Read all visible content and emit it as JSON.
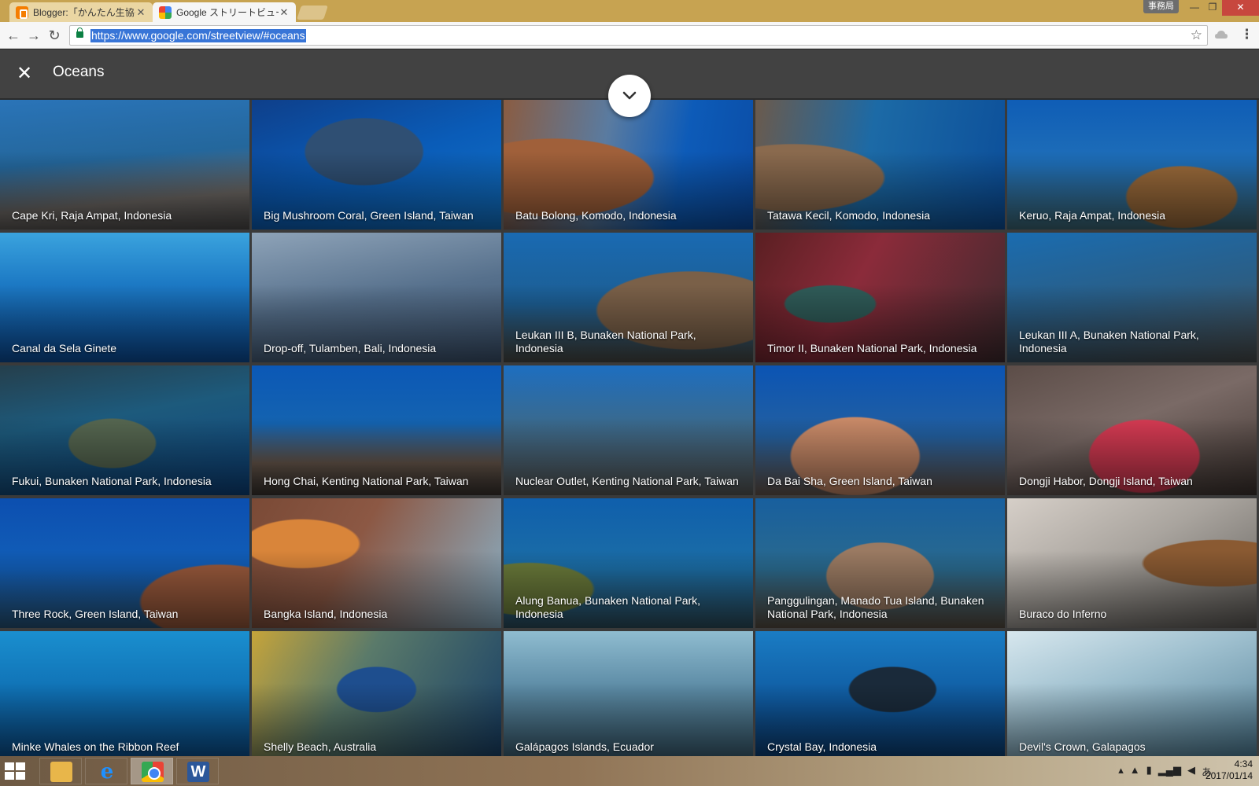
{
  "browser": {
    "tabs": [
      {
        "label": "Blogger:「かんたん生協ゲ",
        "favicon": "blogger-icon"
      },
      {
        "label": "Google ストリートビュー – ",
        "favicon": "street-view-icon"
      }
    ],
    "profile_badge": "事務局",
    "url": "https://www.google.com/streetview/#oceans",
    "colors": {
      "frame": "#c7a351",
      "selection": "#3875d7",
      "lock": "#0b8043"
    }
  },
  "page": {
    "title": "Oceans",
    "close_icon": "close-icon",
    "collapse_icon": "chevron-down-icon",
    "header_color": "#424242"
  },
  "tiles": [
    "Cape Kri, Raja Ampat, Indonesia",
    "Big Mushroom Coral, Green Island, Taiwan",
    "Batu Bolong, Komodo, Indonesia",
    "Tatawa Kecil, Komodo, Indonesia",
    "Keruo, Raja Ampat, Indonesia",
    "Canal da Sela Ginete",
    "Drop-off, Tulamben, Bali, Indonesia",
    "Leukan III B, Bunaken National Park, Indonesia",
    "Timor II, Bunaken National Park, Indonesia",
    "Leukan III A, Bunaken National Park, Indonesia",
    "Fukui, Bunaken National Park, Indonesia",
    "Hong Chai, Kenting National Park, Taiwan",
    "Nuclear Outlet, Kenting National Park, Taiwan",
    "Da Bai Sha, Green Island, Taiwan",
    "Dongji Habor, Dongji Island, Taiwan",
    "Three Rock, Green Island, Taiwan",
    "Bangka Island, Indonesia",
    "Alung Banua, Bunaken National Park, Indonesia",
    "Panggulingan, Manado Tua Island, Bunaken National Park, Indonesia",
    "Buraco do Inferno",
    "Minke Whales on the Ribbon Reef",
    "Shelly Beach, Australia",
    "Galápagos Islands, Ecuador",
    "Crystal Bay, Indonesia",
    "Devil's Crown, Galapagos"
  ],
  "taskbar": {
    "apps": [
      "windows-start-icon",
      "file-explorer-icon",
      "internet-explorer-icon",
      "chrome-icon",
      "word-icon"
    ],
    "active_app": "chrome-icon",
    "tray_input_mode": "あ",
    "time": "4:34",
    "date": "2017/01/14"
  }
}
